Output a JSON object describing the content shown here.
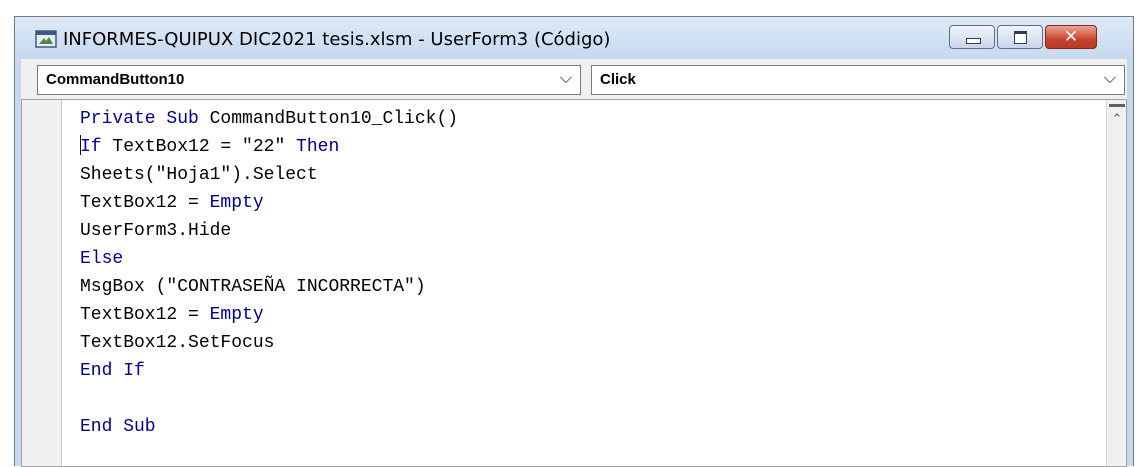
{
  "window": {
    "title": "INFORMES-QUIPUX DIC2021 tesis.xlsm - UserForm3 (Código)",
    "icon": "vba-module-icon",
    "controls": {
      "minimize_icon": "minimize-icon",
      "maximize_icon": "maximize-icon",
      "close_icon": "close-icon",
      "close_glyph": "✕"
    }
  },
  "toolbar": {
    "object_dropdown": {
      "value": "CommandButton10",
      "icon": "chevron-down-icon",
      "glyph": "⌵"
    },
    "procedure_dropdown": {
      "value": "Click",
      "icon": "chevron-down-icon",
      "glyph": "⌵"
    }
  },
  "code": {
    "lines": [
      [
        {
          "t": "Private Sub ",
          "k": 1
        },
        {
          "t": "CommandButton10_Click()",
          "k": 0
        }
      ],
      [
        {
          "t": "If",
          "k": 1
        },
        {
          "t": " TextBox12 = \"22\" ",
          "k": 0
        },
        {
          "t": "Then",
          "k": 1
        }
      ],
      [
        {
          "t": "Sheets(\"Hoja1\").Select",
          "k": 0
        }
      ],
      [
        {
          "t": "TextBox12 = ",
          "k": 0
        },
        {
          "t": "Empty",
          "k": 1
        }
      ],
      [
        {
          "t": "UserForm3.Hide",
          "k": 0
        }
      ],
      [
        {
          "t": "Else",
          "k": 1
        }
      ],
      [
        {
          "t": "MsgBox (\"CONTRASEÑA INCORRECTA\")",
          "k": 0
        }
      ],
      [
        {
          "t": "TextBox12 = ",
          "k": 0
        },
        {
          "t": "Empty",
          "k": 1
        }
      ],
      [
        {
          "t": "TextBox12.SetFocus",
          "k": 0
        }
      ],
      [
        {
          "t": "End If",
          "k": 1
        }
      ],
      [],
      [
        {
          "t": "End Sub",
          "k": 1
        }
      ]
    ],
    "caret_line": 1
  },
  "scrollbar": {
    "up_icon": "scroll-up-icon",
    "glyph": "⌃"
  },
  "colors": {
    "keyword": "#00008b",
    "text": "#000000",
    "title_bar": "#c6d9ef",
    "close_button": "#c7442e"
  }
}
